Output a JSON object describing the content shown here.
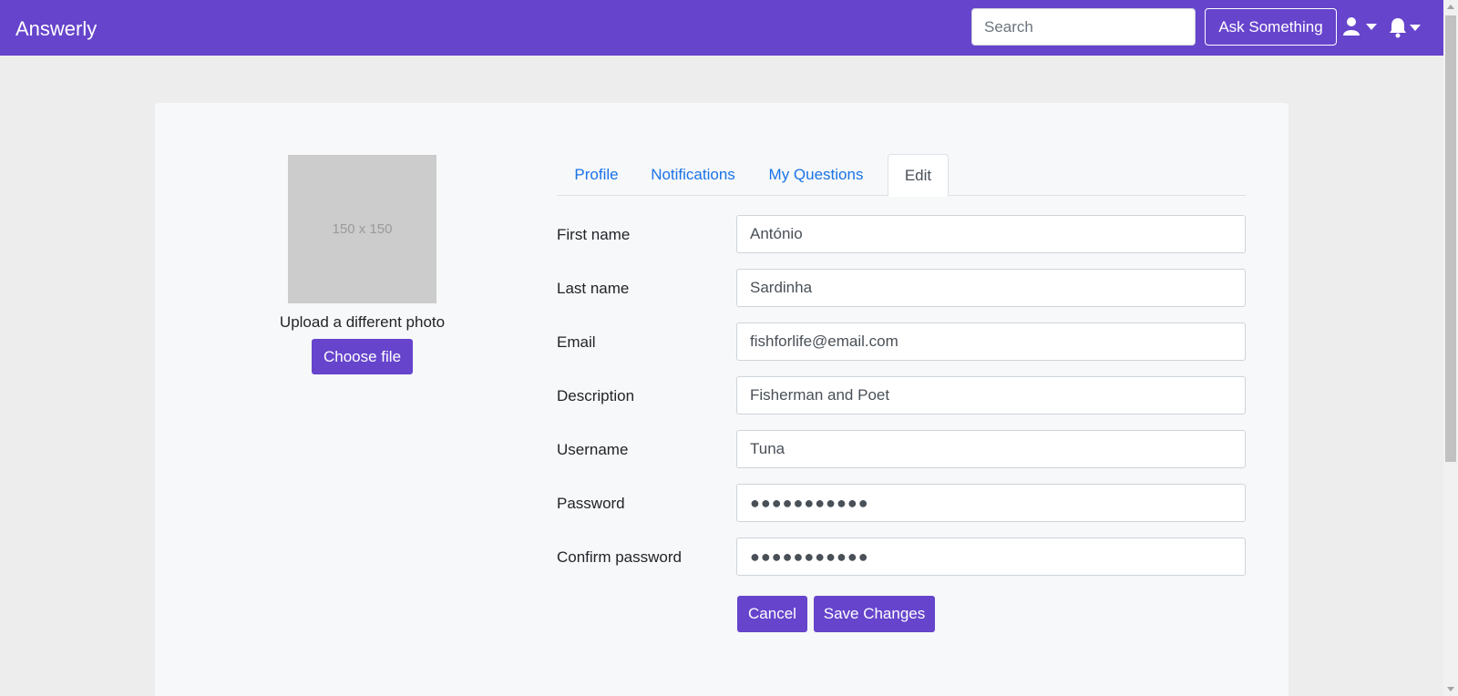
{
  "app": {
    "brand": "Answerly"
  },
  "header": {
    "search_placeholder": "Search",
    "ask_label": "Ask Something",
    "user_icon": "user-icon",
    "bell_icon": "bell-icon"
  },
  "profile": {
    "photo_placeholder": "150 x 150",
    "upload_label": "Upload a different photo",
    "choose_file_label": "Choose file"
  },
  "tabs": [
    {
      "label": "Profile",
      "active": false
    },
    {
      "label": "Notifications",
      "active": false
    },
    {
      "label": "My Questions",
      "active": false
    },
    {
      "label": "Edit",
      "active": true
    }
  ],
  "form": {
    "fields": [
      {
        "label": "First name",
        "value": "António"
      },
      {
        "label": "Last name",
        "value": "Sardinha"
      },
      {
        "label": "Email",
        "value": "fishforlife@email.com"
      },
      {
        "label": "Description",
        "value": "Fisherman and Poet"
      },
      {
        "label": "Username",
        "value": "Tuna"
      },
      {
        "label": "Password",
        "value": "●●●●●●●●●●●"
      },
      {
        "label": "Confirm password",
        "value": "●●●●●●●●●●●"
      }
    ],
    "cancel_label": "Cancel",
    "save_label": "Save Changes"
  },
  "colors": {
    "brand": "#6644cc",
    "link": "#1a73e8",
    "background": "#ededed",
    "card": "#f7f8f9"
  }
}
